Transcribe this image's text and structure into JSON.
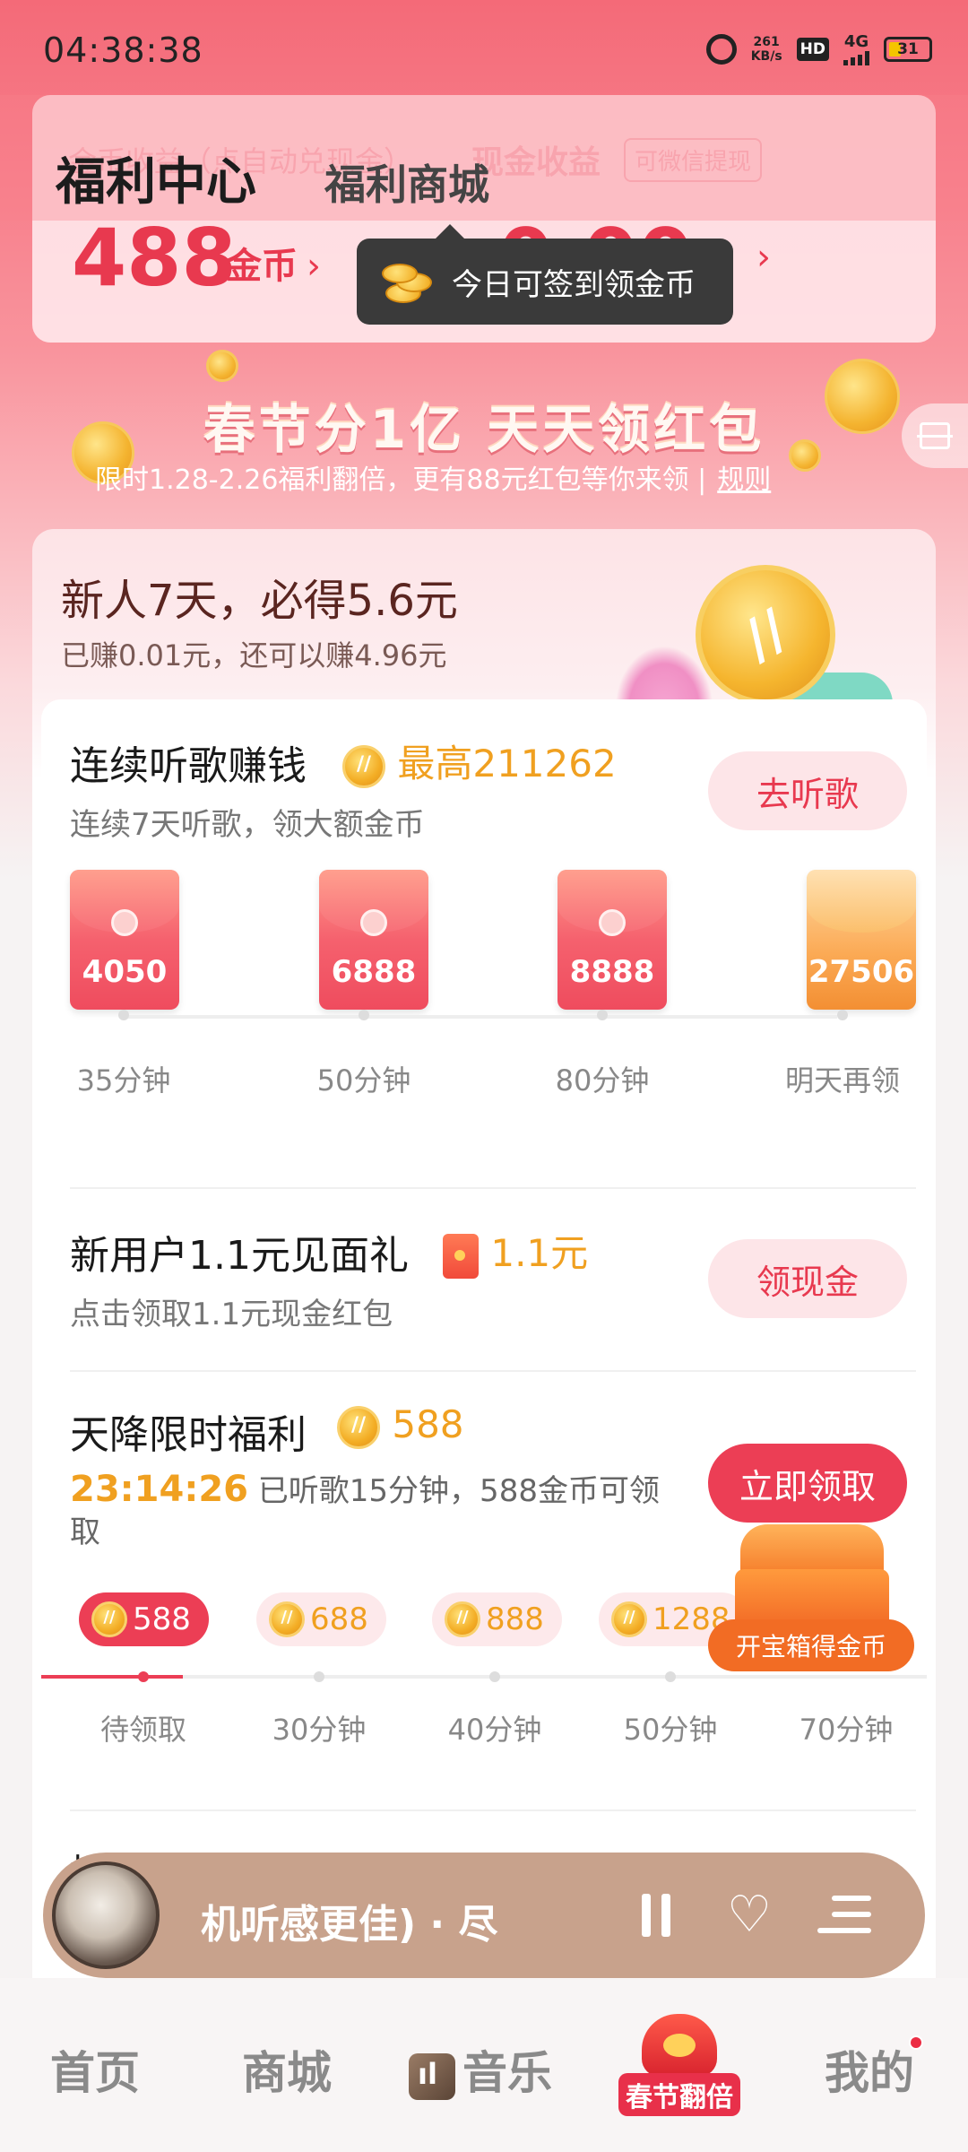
{
  "status_bar": {
    "time": "04:38:38",
    "net_speed_value": "261",
    "net_speed_unit": "KB/s",
    "hd_label": "HD",
    "network": "4G",
    "battery": "31",
    "battery_level": 0.31
  },
  "header": {
    "title": "福利中心",
    "tab_mall": "福利商城",
    "ghost_text_1": "金币收益（点自动兑现金）",
    "ghost_text_2": "现金收益",
    "ghost_text_3": "可微信提现",
    "coins_value": "488",
    "coins_unit": "金币",
    "chevron": "›",
    "cash_value": "0.00",
    "cash_chevron": "›"
  },
  "tooltip": {
    "text": "今日可签到领金币",
    "icon": "gold-coins-icon"
  },
  "banner": {
    "title": "春节分1亿 天天领红包",
    "subtitle": "限时1.28-2.26福利翻倍，更有88元红包等你来领 |",
    "rules_link": "规则"
  },
  "newbie": {
    "title": "新人7天，必得5.6元",
    "subtitle": "已赚0.01元，还可以赚4.96元"
  },
  "listen_task": {
    "title": "连续听歌赚钱",
    "highlight": "最高211262",
    "subtitle": "连续7天听歌，领大额金币",
    "button": "去听歌",
    "rewards": [
      {
        "amount": "4050",
        "label": "35分钟",
        "type": "red"
      },
      {
        "amount": "6888",
        "label": "50分钟",
        "type": "red"
      },
      {
        "amount": "8888",
        "label": "80分钟",
        "type": "red"
      },
      {
        "amount": "27506",
        "label": "明天再领",
        "type": "gold"
      }
    ]
  },
  "new_user_gift": {
    "title": "新用户1.1元见面礼",
    "highlight": "1.1元",
    "subtitle": "点击领取1.1元现金红包",
    "button": "领现金"
  },
  "limited_bonus": {
    "title": "天降限时福利",
    "highlight": "588",
    "countdown": "23:14:26",
    "desc_line1": "已听歌15分钟，588金币可领",
    "desc_line2": "取",
    "button": "立即领取",
    "progress_fraction": 0.16,
    "steps": [
      {
        "coins": "588",
        "label": "待领取",
        "active": true
      },
      {
        "coins": "688",
        "label": "30分钟",
        "active": false
      },
      {
        "coins": "888",
        "label": "40分钟",
        "active": false
      },
      {
        "coins": "1288",
        "label": "50分钟",
        "active": false
      },
      {
        "coins": "",
        "label": "70分钟",
        "active": false
      }
    ],
    "treasure_label": "开宝箱得金币"
  },
  "withdraw": {
    "title": "提现1元"
  },
  "player": {
    "song_text": "机听感更佳) · 尽",
    "cover_icon": "album-cover-image",
    "pause_icon": "pause-icon",
    "like_icon": "heart-icon",
    "playlist_icon": "playlist-icon",
    "heart_glyph": "♡"
  },
  "bottom_nav": {
    "home": "首页",
    "mall": "商城",
    "music": "音乐",
    "spring": "春节翻倍",
    "mine": "我的"
  },
  "colors": {
    "accent_red": "#e8394f",
    "button_red": "#ec3e55",
    "gold": "#f0a020",
    "player_bg": "#c8a28c"
  }
}
